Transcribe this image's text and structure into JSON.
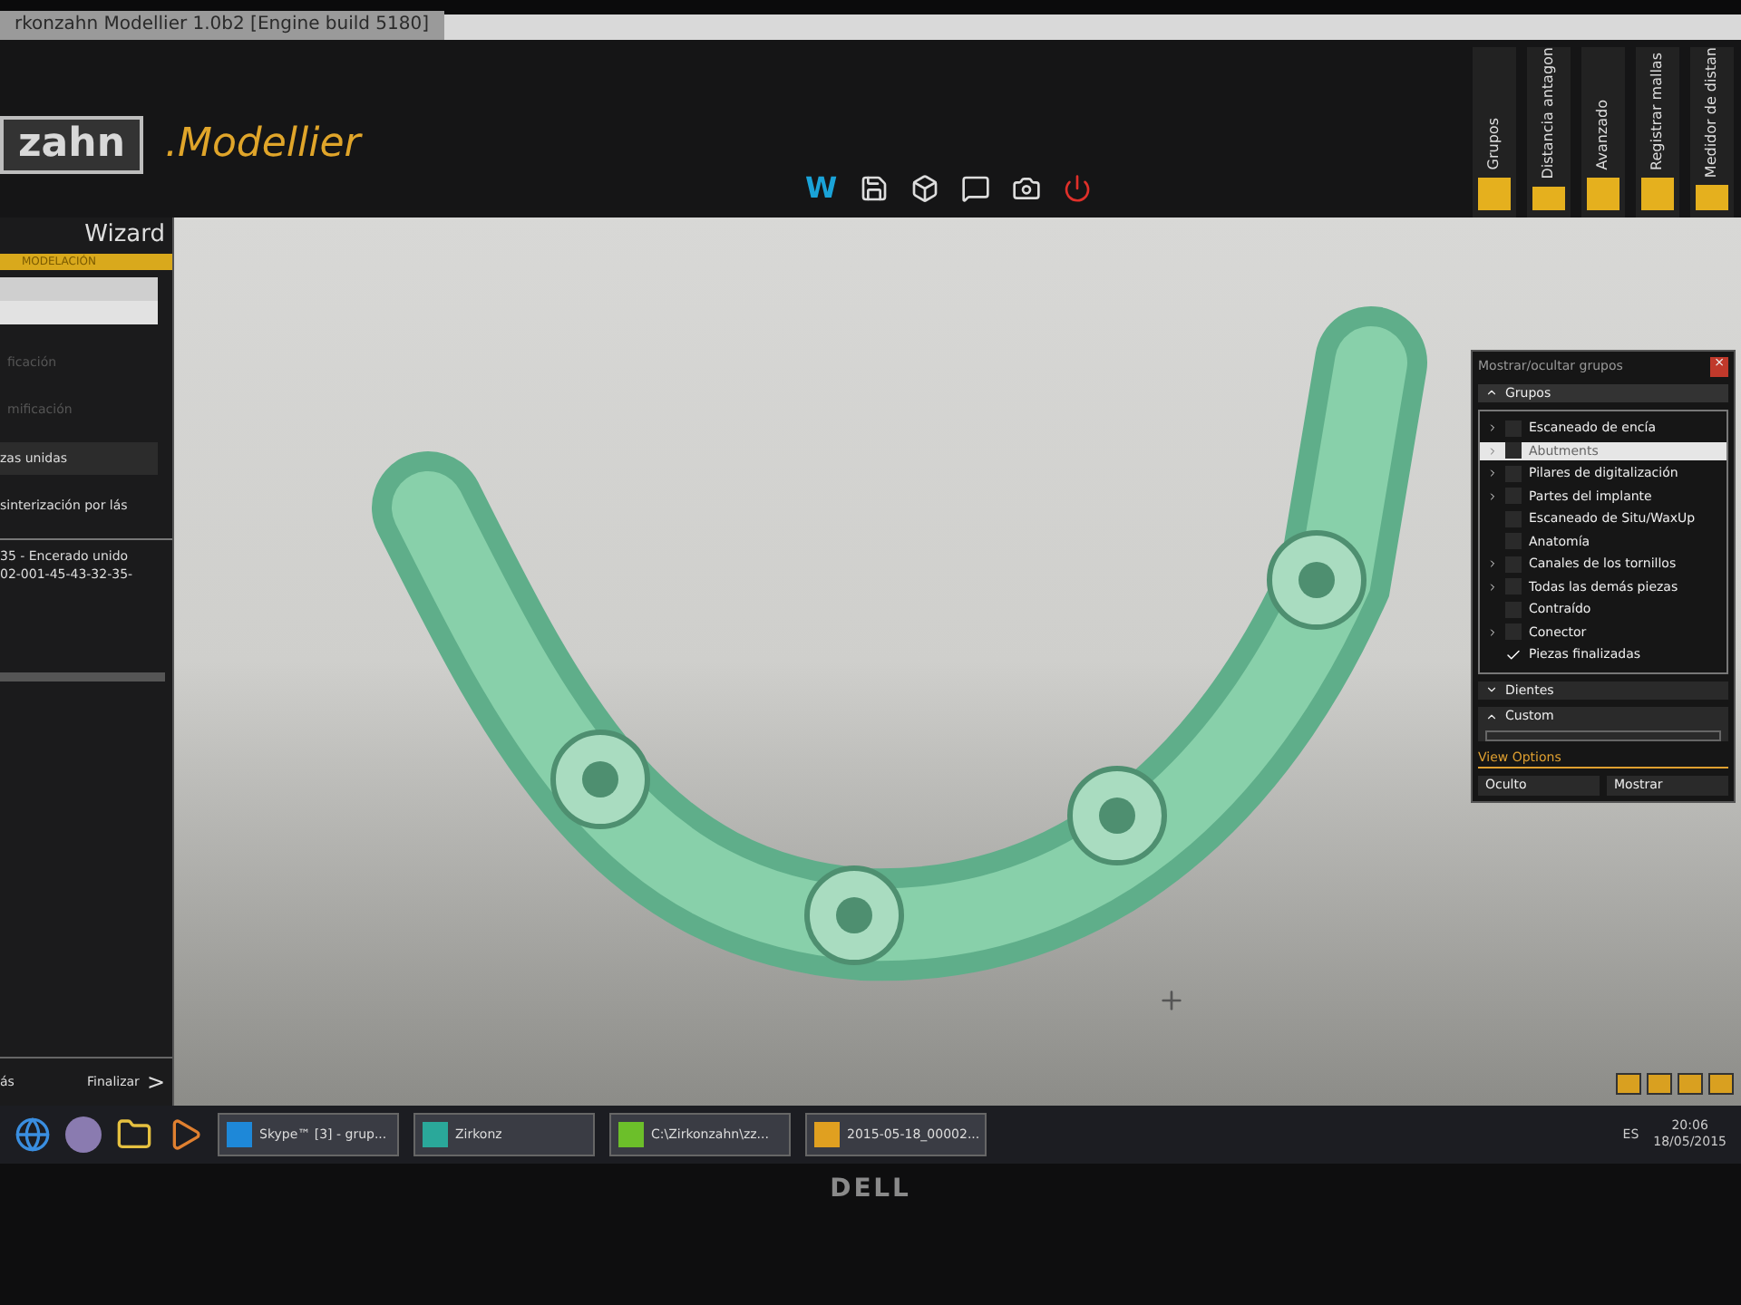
{
  "window": {
    "title": "rkonzahn Modellier 1.0b2 [Engine build 5180]"
  },
  "header": {
    "logo": "zahn",
    "app_name": ".Modellier",
    "toolbar_w": "W"
  },
  "side_tabs": [
    {
      "label": "Grupos"
    },
    {
      "label": "Distancia antagon"
    },
    {
      "label": "Avanzado"
    },
    {
      "label": "Registrar mallas"
    },
    {
      "label": "Medidor de distan"
    }
  ],
  "wizard": {
    "title": "Wizard",
    "step": "MODELACIÓN",
    "faded_items": [
      "ficación",
      "mificación"
    ],
    "button": "zas unidas",
    "option": "sinterización por lás",
    "list": [
      "35  - Encerado unido",
      "02-001-45-43-32-35-"
    ],
    "back": "ás",
    "finish": "Finalizar",
    "finish_arrow": ">"
  },
  "groups_panel": {
    "title": "Mostrar/ocultar grupos",
    "close": "×",
    "section": "Grupos",
    "items": [
      {
        "label": "Escaneado de encía",
        "expandable": true,
        "checked": false,
        "selected": false
      },
      {
        "label": "Abutments",
        "expandable": true,
        "checked": false,
        "selected": true
      },
      {
        "label": "Pilares de digitalización",
        "expandable": true,
        "checked": false,
        "selected": false
      },
      {
        "label": "Partes del implante",
        "expandable": true,
        "checked": false,
        "selected": false
      },
      {
        "label": "Escaneado de Situ/WaxUp",
        "expandable": false,
        "checked": false,
        "selected": false
      },
      {
        "label": "Anatomía",
        "expandable": false,
        "checked": false,
        "selected": false
      },
      {
        "label": "Canales de los tornillos",
        "expandable": true,
        "checked": false,
        "selected": false
      },
      {
        "label": "Todas las demás piezas",
        "expandable": true,
        "checked": false,
        "selected": false
      },
      {
        "label": "Contraído",
        "expandable": false,
        "checked": false,
        "selected": false
      },
      {
        "label": "Conector",
        "expandable": true,
        "checked": false,
        "selected": false
      },
      {
        "label": "Piezas finalizadas",
        "expandable": false,
        "checked": true,
        "selected": false
      }
    ],
    "sections": [
      {
        "label": "Dientes",
        "expanded": false
      },
      {
        "label": "Custom",
        "expanded": true
      }
    ],
    "view_options": "View Options",
    "buttons": [
      "Oculto",
      "Mostrar"
    ]
  },
  "taskbar": {
    "apps": [
      {
        "label": "Skype™ [3] - grup...",
        "color": "#1e88d8"
      },
      {
        "label": "Zirkonz",
        "color": "#2aa89a"
      },
      {
        "label": "C:\\Zirkonzahn\\zz...",
        "color": "#6cbf2a"
      },
      {
        "label": "2015-05-18_00002...",
        "color": "#e0a020"
      }
    ],
    "language": "ES",
    "time": "20:06",
    "date": "18/05/2015"
  },
  "monitor": {
    "brand": "DELL"
  }
}
